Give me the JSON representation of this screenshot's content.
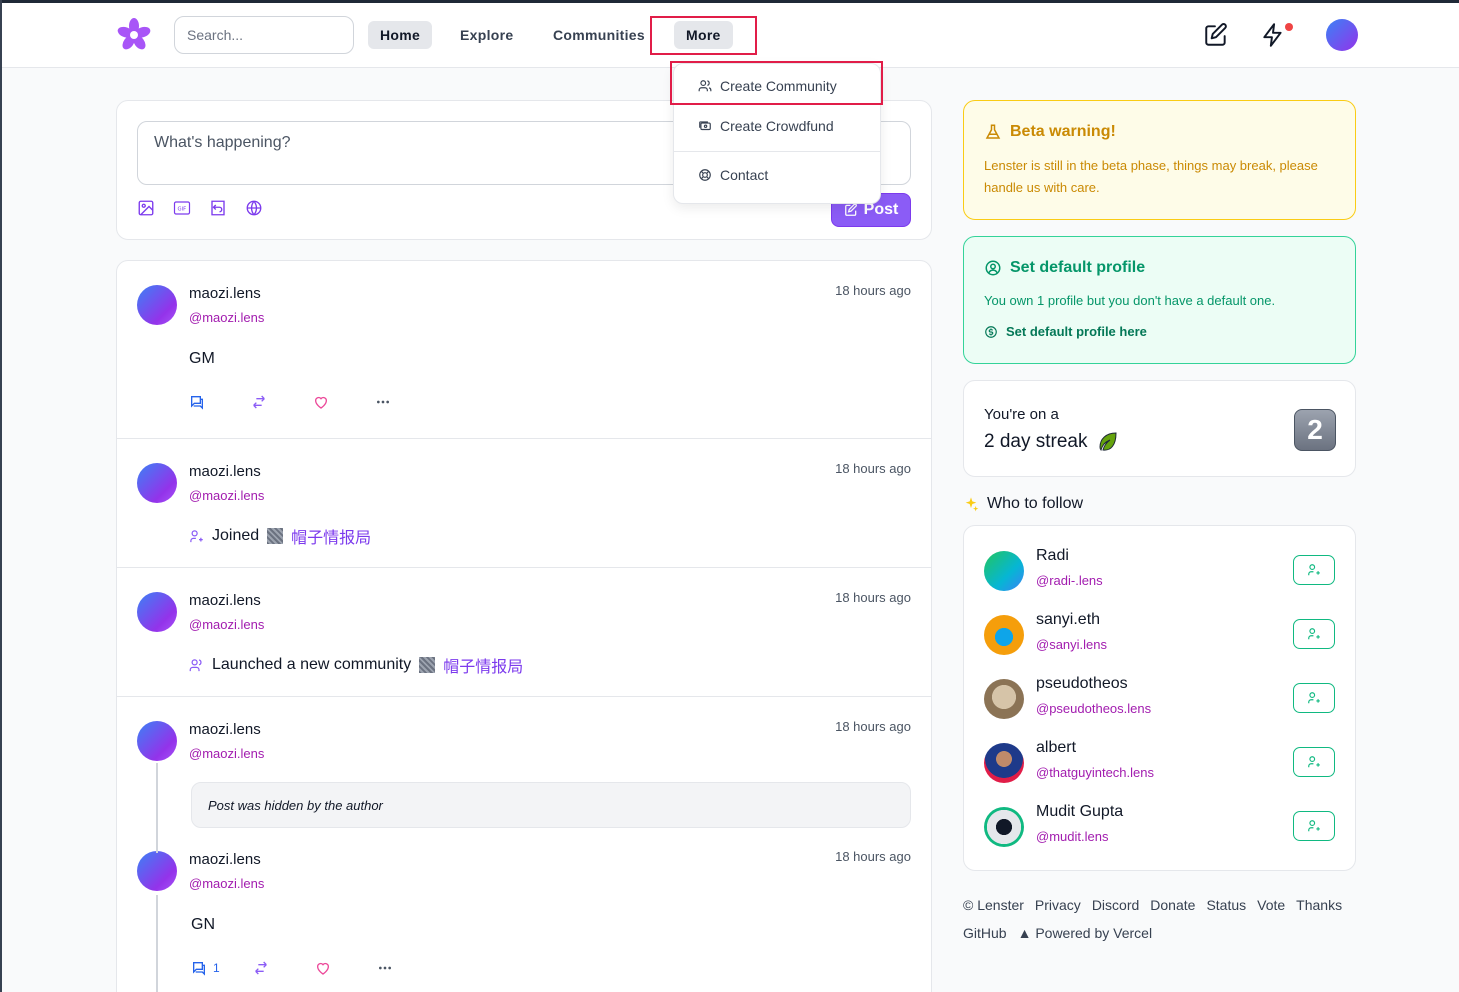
{
  "header": {
    "search_placeholder": "Search...",
    "nav": {
      "home": "Home",
      "explore": "Explore",
      "communities": "Communities",
      "more": "More"
    }
  },
  "more_menu": {
    "create_community": "Create Community",
    "create_crowdfund": "Create Crowdfund",
    "contact": "Contact"
  },
  "composer": {
    "placeholder": "What's happening?",
    "post_label": "Post"
  },
  "feed": [
    {
      "name": "maozi.lens",
      "handle": "@maozi.lens",
      "time": "18 hours ago",
      "body": "GM"
    },
    {
      "name": "maozi.lens",
      "handle": "@maozi.lens",
      "time": "18 hours ago",
      "action": "Joined",
      "community": "帽子情报局"
    },
    {
      "name": "maozi.lens",
      "handle": "@maozi.lens",
      "time": "18 hours ago",
      "action": "Launched a new community",
      "community": "帽子情报局"
    },
    {
      "name": "maozi.lens",
      "handle": "@maozi.lens",
      "time": "18 hours ago",
      "hidden_text": "Post was hidden by the author"
    },
    {
      "name": "maozi.lens",
      "handle": "@maozi.lens",
      "time": "18 hours ago",
      "body": "GN",
      "comment_count": "1"
    }
  ],
  "sidebar": {
    "beta": {
      "title": "Beta warning!",
      "text": "Lenster is still in the beta phase, things may break, please handle us with care."
    },
    "default_profile": {
      "title": "Set default profile",
      "text": "You own 1 profile but you don't have a default one.",
      "link": "Set default profile here"
    },
    "streak": {
      "line1": "You're on a",
      "line2": "2 day streak",
      "number": "2"
    },
    "who_to_follow": {
      "title": "Who to follow",
      "users": [
        {
          "name": "Radi",
          "handle": "@radi-.lens"
        },
        {
          "name": "sanyi.eth",
          "handle": "@sanyi.lens"
        },
        {
          "name": "pseudotheos",
          "handle": "@pseudotheos.lens"
        },
        {
          "name": "albert",
          "handle": "@thatguyintech.lens"
        },
        {
          "name": "Mudit Gupta",
          "handle": "@mudit.lens"
        }
      ]
    },
    "footer": {
      "links": [
        "© Lenster",
        "Privacy",
        "Discord",
        "Donate",
        "Status",
        "Vote",
        "Thanks",
        "GitHub"
      ],
      "powered": "▲ Powered by Vercel"
    }
  }
}
